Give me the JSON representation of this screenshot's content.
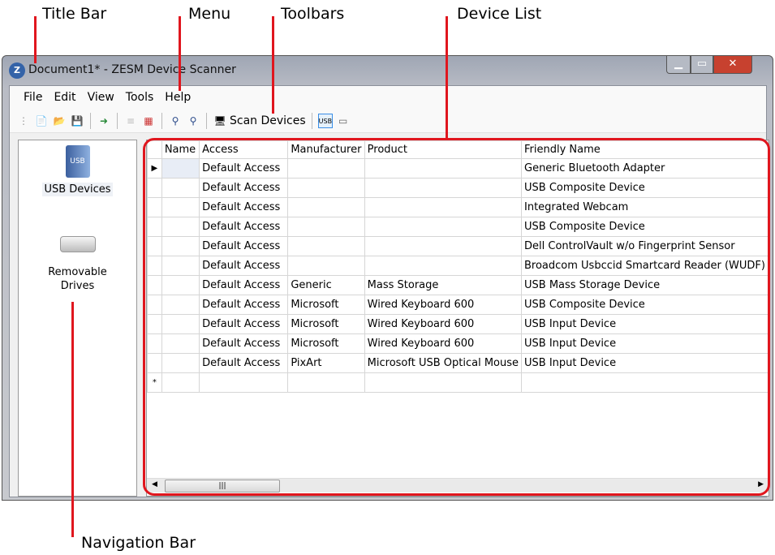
{
  "annotations": {
    "title_bar": "Title Bar",
    "menu": "Menu",
    "toolbars": "Toolbars",
    "device_list": "Device List",
    "navigation_bar": "Navigation Bar"
  },
  "window": {
    "title": "Document1* - ZESM Device Scanner"
  },
  "menu": [
    "File",
    "Edit",
    "View",
    "Tools",
    "Help"
  ],
  "toolbar": {
    "scan_label": "Scan Devices"
  },
  "nav": {
    "items": [
      {
        "label": "USB Devices"
      },
      {
        "label": "Removable Drives"
      }
    ]
  },
  "grid": {
    "columns": [
      "Name",
      "Access",
      "Manufacturer",
      "Product",
      "Friendly Name"
    ],
    "rows": [
      [
        "",
        "Default Access",
        "",
        "",
        "Generic Bluetooth Adapter"
      ],
      [
        "",
        "Default Access",
        "",
        "",
        "USB Composite Device"
      ],
      [
        "",
        "Default Access",
        "",
        "",
        "Integrated Webcam"
      ],
      [
        "",
        "Default Access",
        "",
        "",
        "USB Composite Device"
      ],
      [
        "",
        "Default Access",
        "",
        "",
        "Dell ControlVault w/o Fingerprint Sensor"
      ],
      [
        "",
        "Default Access",
        "",
        "",
        "Broadcom Usbccid Smartcard Reader (WUDF)"
      ],
      [
        "",
        "Default Access",
        "Generic",
        "Mass Storage",
        "USB Mass Storage Device"
      ],
      [
        "",
        "Default Access",
        "Microsoft",
        "Wired Keyboard 600",
        "USB Composite Device"
      ],
      [
        "",
        "Default Access",
        "Microsoft",
        "Wired Keyboard 600",
        "USB Input Device"
      ],
      [
        "",
        "Default Access",
        "Microsoft",
        "Wired Keyboard 600",
        "USB Input Device"
      ],
      [
        "",
        "Default Access",
        "PixArt",
        "Microsoft USB Optical Mouse",
        "USB Input Device"
      ]
    ],
    "current_row_marker": "▶",
    "new_row_marker": "*"
  }
}
